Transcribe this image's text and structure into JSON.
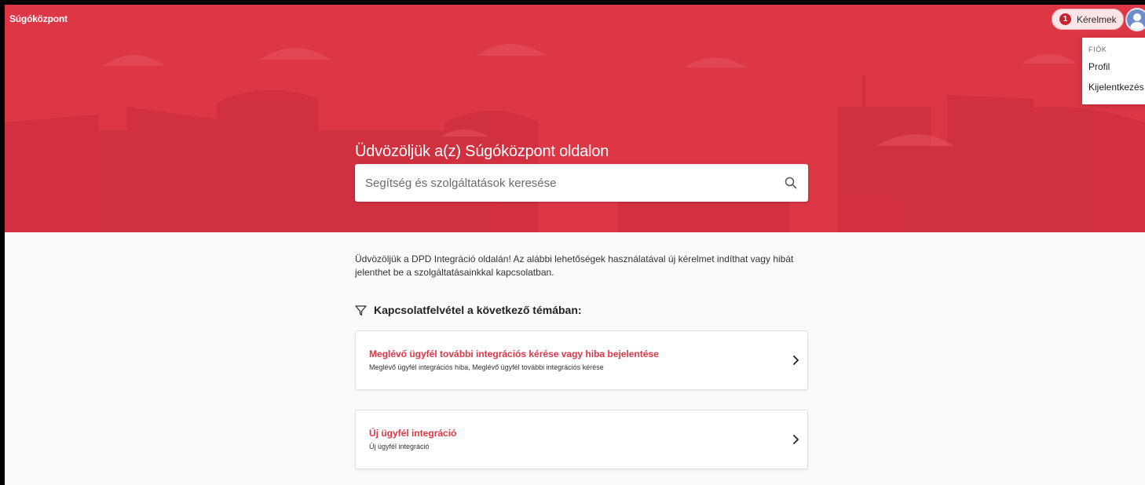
{
  "colors": {
    "brand": "#dd3645",
    "badge": "#c8212f",
    "page_background": "#f9fafb"
  },
  "header": {
    "brand_label": "Súgóközpont",
    "requests": {
      "count": "1",
      "label": "Kérelmek"
    },
    "avatar_icon": "user-avatar-icon"
  },
  "account_menu": {
    "heading": "FIÓK",
    "items": [
      {
        "label": "Profil"
      },
      {
        "label": "Kijelentkezés"
      }
    ]
  },
  "hero": {
    "title": "Üdvözöljük a(z) Súgóközpont oldalon",
    "search": {
      "placeholder": "Segítség és szolgáltatások keresése",
      "value": "",
      "icon": "search-icon"
    }
  },
  "main": {
    "intro": "Üdvözöljük a DPD Integráció oldalán! Az alábbi lehetőségek használatával új kérelmet indíthat vagy hibát jelenthet be a szolgáltatásainkkal kapcsolatban.",
    "section_title": "Kapcsolatfelvétel a következő témában:",
    "section_icon": "filter-icon",
    "options": [
      {
        "title": "Meglévő ügyfél további integrációs kérése vagy hiba bejelentése",
        "description": "Meglévő ügyfél integrációs hiba, Meglévő ügyfél további integrációs kérése"
      },
      {
        "title": "Új ügyfél integráció",
        "description": "Új ügyfél integráció"
      }
    ]
  }
}
